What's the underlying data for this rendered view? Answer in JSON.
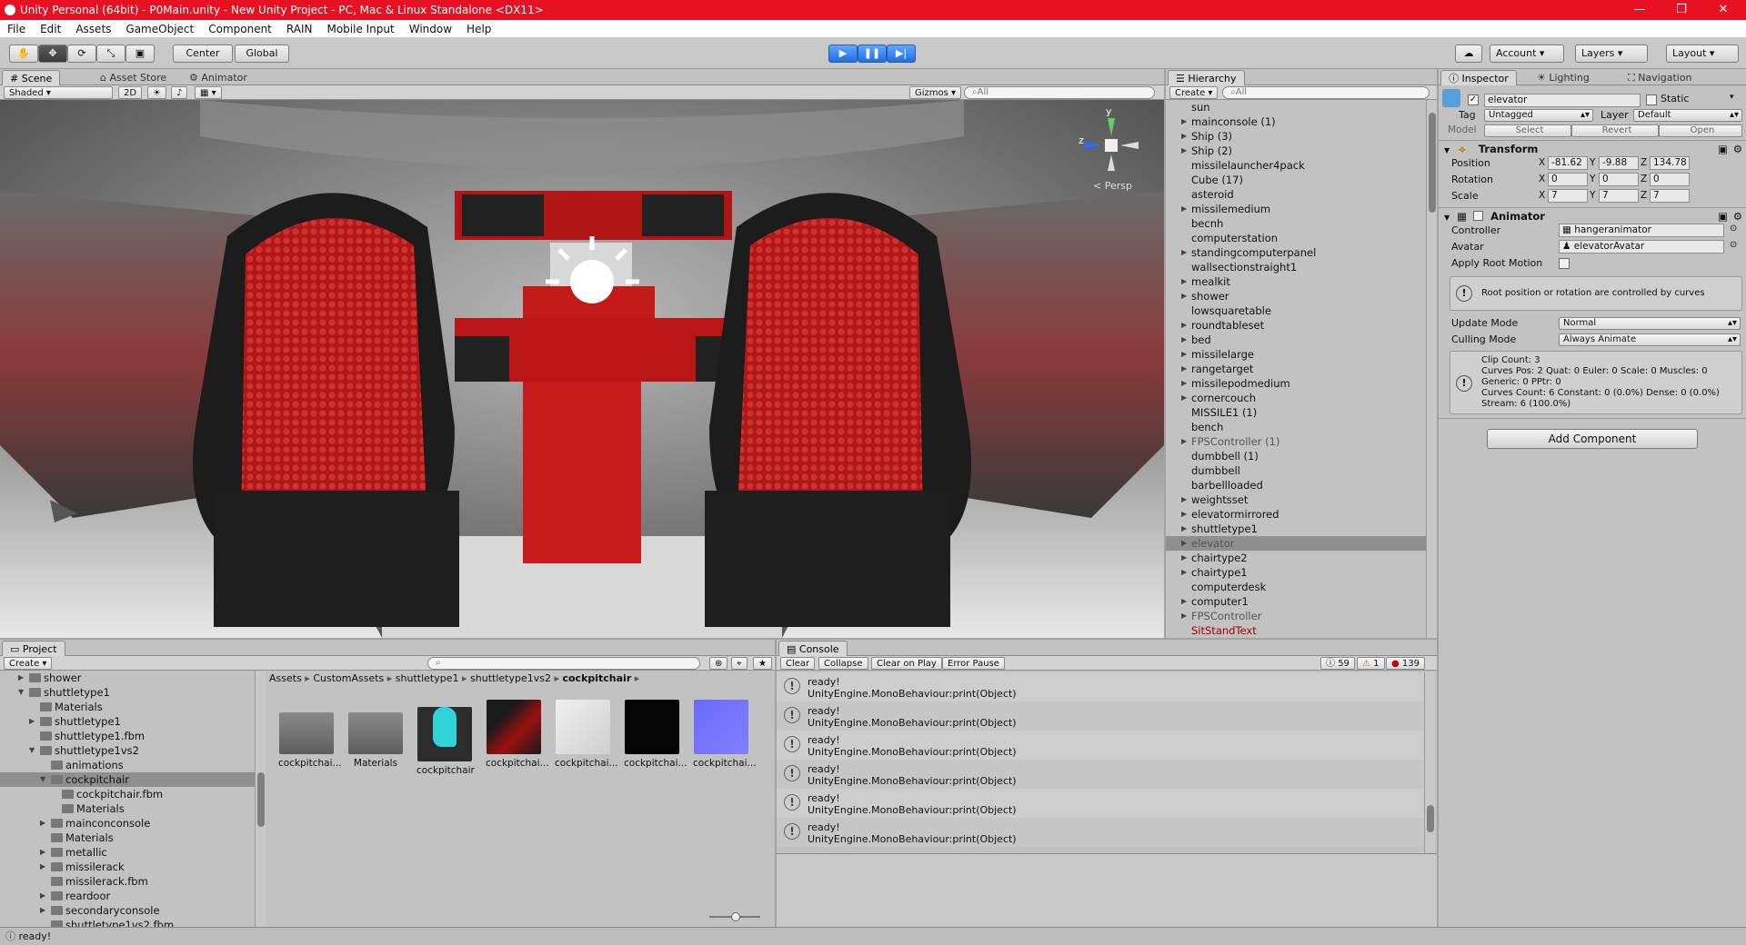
{
  "window": {
    "title": "Unity Personal (64bit) - P0Main.unity - New Unity Project - PC, Mac & Linux Standalone <DX11>",
    "controls": [
      "—",
      "❐",
      "✕"
    ]
  },
  "menu": [
    "File",
    "Edit",
    "Assets",
    "GameObject",
    "Component",
    "RAIN",
    "Mobile Input",
    "Window",
    "Help"
  ],
  "toolbar": {
    "pivot_label": "Center",
    "space_label": "Global",
    "account_label": "Account",
    "layers_label": "Layers",
    "layout_label": "Layout"
  },
  "scene_panel": {
    "tabs": [
      "Scene",
      "Asset Store",
      "Animator"
    ],
    "shading_mode": "Shaded",
    "mode_2d": "2D",
    "gizmos_label": "Gizmos",
    "search_placeholder": "All",
    "persp_label": "< Persp",
    "axis_labels": {
      "y": "y",
      "z": "z"
    }
  },
  "hierarchy": {
    "tab": "Hierarchy",
    "create_label": "Create",
    "search_placeholder": "All",
    "items": [
      {
        "label": "sun",
        "arrow": false,
        "state": ""
      },
      {
        "label": "mainconsole (1)",
        "arrow": true,
        "state": ""
      },
      {
        "label": "Ship (3)",
        "arrow": true,
        "state": ""
      },
      {
        "label": "Ship (2)",
        "arrow": true,
        "state": ""
      },
      {
        "label": "missilelauncher4pack",
        "arrow": false,
        "state": ""
      },
      {
        "label": "Cube (17)",
        "arrow": false,
        "state": ""
      },
      {
        "label": "asteroid",
        "arrow": false,
        "state": ""
      },
      {
        "label": "missilemedium",
        "arrow": true,
        "state": ""
      },
      {
        "label": "becnh",
        "arrow": false,
        "state": ""
      },
      {
        "label": "computerstation",
        "arrow": false,
        "state": ""
      },
      {
        "label": "standingcomputerpanel",
        "arrow": true,
        "state": ""
      },
      {
        "label": "wallsectionstraight1",
        "arrow": false,
        "state": ""
      },
      {
        "label": "mealkit",
        "arrow": true,
        "state": ""
      },
      {
        "label": "shower",
        "arrow": true,
        "state": ""
      },
      {
        "label": "lowsquaretable",
        "arrow": false,
        "state": ""
      },
      {
        "label": "roundtableset",
        "arrow": true,
        "state": ""
      },
      {
        "label": "bed",
        "arrow": true,
        "state": ""
      },
      {
        "label": "missilelarge",
        "arrow": true,
        "state": ""
      },
      {
        "label": "rangetarget",
        "arrow": true,
        "state": ""
      },
      {
        "label": "missilepodmedium",
        "arrow": true,
        "state": ""
      },
      {
        "label": "cornercouch",
        "arrow": true,
        "state": ""
      },
      {
        "label": "MISSILE1 (1)",
        "arrow": false,
        "state": ""
      },
      {
        "label": "bench",
        "arrow": false,
        "state": ""
      },
      {
        "label": "FPSController (1)",
        "arrow": true,
        "state": "dim"
      },
      {
        "label": "dumbbell (1)",
        "arrow": false,
        "state": ""
      },
      {
        "label": "dumbbell",
        "arrow": false,
        "state": ""
      },
      {
        "label": "barbellloaded",
        "arrow": false,
        "state": ""
      },
      {
        "label": "weightsset",
        "arrow": true,
        "state": ""
      },
      {
        "label": "elevatormirrored",
        "arrow": true,
        "state": ""
      },
      {
        "label": "shuttletype1",
        "arrow": true,
        "state": ""
      },
      {
        "label": "elevator",
        "arrow": true,
        "state": "sel"
      },
      {
        "label": "chairtype2",
        "arrow": true,
        "state": ""
      },
      {
        "label": "chairtype1",
        "arrow": true,
        "state": ""
      },
      {
        "label": "computerdesk",
        "arrow": false,
        "state": ""
      },
      {
        "label": "computer1",
        "arrow": true,
        "state": ""
      },
      {
        "label": "FPSController",
        "arrow": true,
        "state": "dim"
      },
      {
        "label": "SitStandText",
        "arrow": false,
        "state": "red"
      }
    ]
  },
  "inspector": {
    "tabs": [
      "Inspector",
      "Lighting",
      "Navigation"
    ],
    "object_name": "elevator",
    "static_label": "Static",
    "tag_label": "Tag",
    "tag_value": "Untagged",
    "layer_label": "Layer",
    "layer_value": "Default",
    "model_label": "Model",
    "model_buttons": [
      "Select",
      "Revert",
      "Open"
    ],
    "transform": {
      "header": "Transform",
      "position_label": "Position",
      "rotation_label": "Rotation",
      "scale_label": "Scale",
      "position": {
        "x": "-81.62",
        "y": "-9.88",
        "z": "134.78"
      },
      "rotation": {
        "x": "0",
        "y": "0",
        "z": "0"
      },
      "scale": {
        "x": "7",
        "y": "7",
        "z": "7"
      }
    },
    "animator": {
      "header": "Animator",
      "controller_label": "Controller",
      "controller_value": "hangeranimator",
      "avatar_label": "Avatar",
      "avatar_value": "elevatorAvatar",
      "apply_root_label": "Apply Root Motion",
      "root_info": "Root position or rotation are controlled by curves",
      "update_mode_label": "Update Mode",
      "update_mode_value": "Normal",
      "culling_mode_label": "Culling Mode",
      "culling_mode_value": "Always Animate",
      "clip_info": [
        "Clip Count: 3",
        "Curves Pos: 2 Quat: 0 Euler: 0 Scale: 0 Muscles: 0",
        "Generic: 0 PPtr: 0",
        "Curves Count: 6 Constant: 0 (0.0%) Dense: 0 (0.0%)",
        "Stream: 6 (100.0%)"
      ]
    },
    "add_component_label": "Add Component"
  },
  "project": {
    "tab": "Project",
    "create_label": "Create",
    "tree": [
      {
        "label": "shower",
        "indent": 1,
        "arrow": "right",
        "sel": false
      },
      {
        "label": "shuttletype1",
        "indent": 1,
        "arrow": "down",
        "sel": false
      },
      {
        "label": "Materials",
        "indent": 2,
        "arrow": "",
        "sel": false
      },
      {
        "label": "shuttletype1",
        "indent": 2,
        "arrow": "right",
        "sel": false
      },
      {
        "label": "shuttletype1.fbm",
        "indent": 2,
        "arrow": "",
        "sel": false
      },
      {
        "label": "shuttletype1vs2",
        "indent": 2,
        "arrow": "down",
        "sel": false
      },
      {
        "label": "animations",
        "indent": 3,
        "arrow": "",
        "sel": false
      },
      {
        "label": "cockpitchair",
        "indent": 3,
        "arrow": "down",
        "sel": true
      },
      {
        "label": "cockpitchair.fbm",
        "indent": 4,
        "arrow": "",
        "sel": false
      },
      {
        "label": "Materials",
        "indent": 4,
        "arrow": "",
        "sel": false
      },
      {
        "label": "mainconconsole",
        "indent": 3,
        "arrow": "right",
        "sel": false
      },
      {
        "label": "Materials",
        "indent": 3,
        "arrow": "",
        "sel": false
      },
      {
        "label": "metallic",
        "indent": 3,
        "arrow": "right",
        "sel": false
      },
      {
        "label": "missilerack",
        "indent": 3,
        "arrow": "right",
        "sel": false
      },
      {
        "label": "missilerack.fbm",
        "indent": 3,
        "arrow": "",
        "sel": false
      },
      {
        "label": "reardoor",
        "indent": 3,
        "arrow": "right",
        "sel": false
      },
      {
        "label": "secondaryconsole",
        "indent": 3,
        "arrow": "right",
        "sel": false
      },
      {
        "label": "shuttletype1vs2.fbm",
        "indent": 3,
        "arrow": "",
        "sel": false
      }
    ],
    "breadcrumb": [
      "Assets",
      "CustomAssets",
      "shuttletype1",
      "shuttletype1vs2",
      "cockpitchair"
    ],
    "assets": [
      {
        "label": "cockpitchai...",
        "kind": "folder"
      },
      {
        "label": "Materials",
        "kind": "folder"
      },
      {
        "label": "cockpitchair",
        "kind": "model"
      },
      {
        "label": "cockpitchai...",
        "kind": "tex-red"
      },
      {
        "label": "cockpitchai...",
        "kind": "tex-white"
      },
      {
        "label": "cockpitchai...",
        "kind": "tex-black"
      },
      {
        "label": "cockpitchai...",
        "kind": "tex-normal"
      }
    ]
  },
  "console": {
    "tab": "Console",
    "buttons": [
      "Clear",
      "Collapse",
      "Clear on Play",
      "Error Pause"
    ],
    "counts": {
      "info": "59",
      "warn": "1",
      "error": "139"
    },
    "entries": [
      {
        "line1": "ready!",
        "line2": "UnityEngine.MonoBehaviour:print(Object)"
      },
      {
        "line1": "ready!",
        "line2": "UnityEngine.MonoBehaviour:print(Object)"
      },
      {
        "line1": "ready!",
        "line2": "UnityEngine.MonoBehaviour:print(Object)"
      },
      {
        "line1": "ready!",
        "line2": "UnityEngine.MonoBehaviour:print(Object)"
      },
      {
        "line1": "ready!",
        "line2": "UnityEngine.MonoBehaviour:print(Object)"
      },
      {
        "line1": "ready!",
        "line2": "UnityEngine.MonoBehaviour:print(Object)"
      }
    ]
  },
  "status": {
    "text": "ready!"
  }
}
